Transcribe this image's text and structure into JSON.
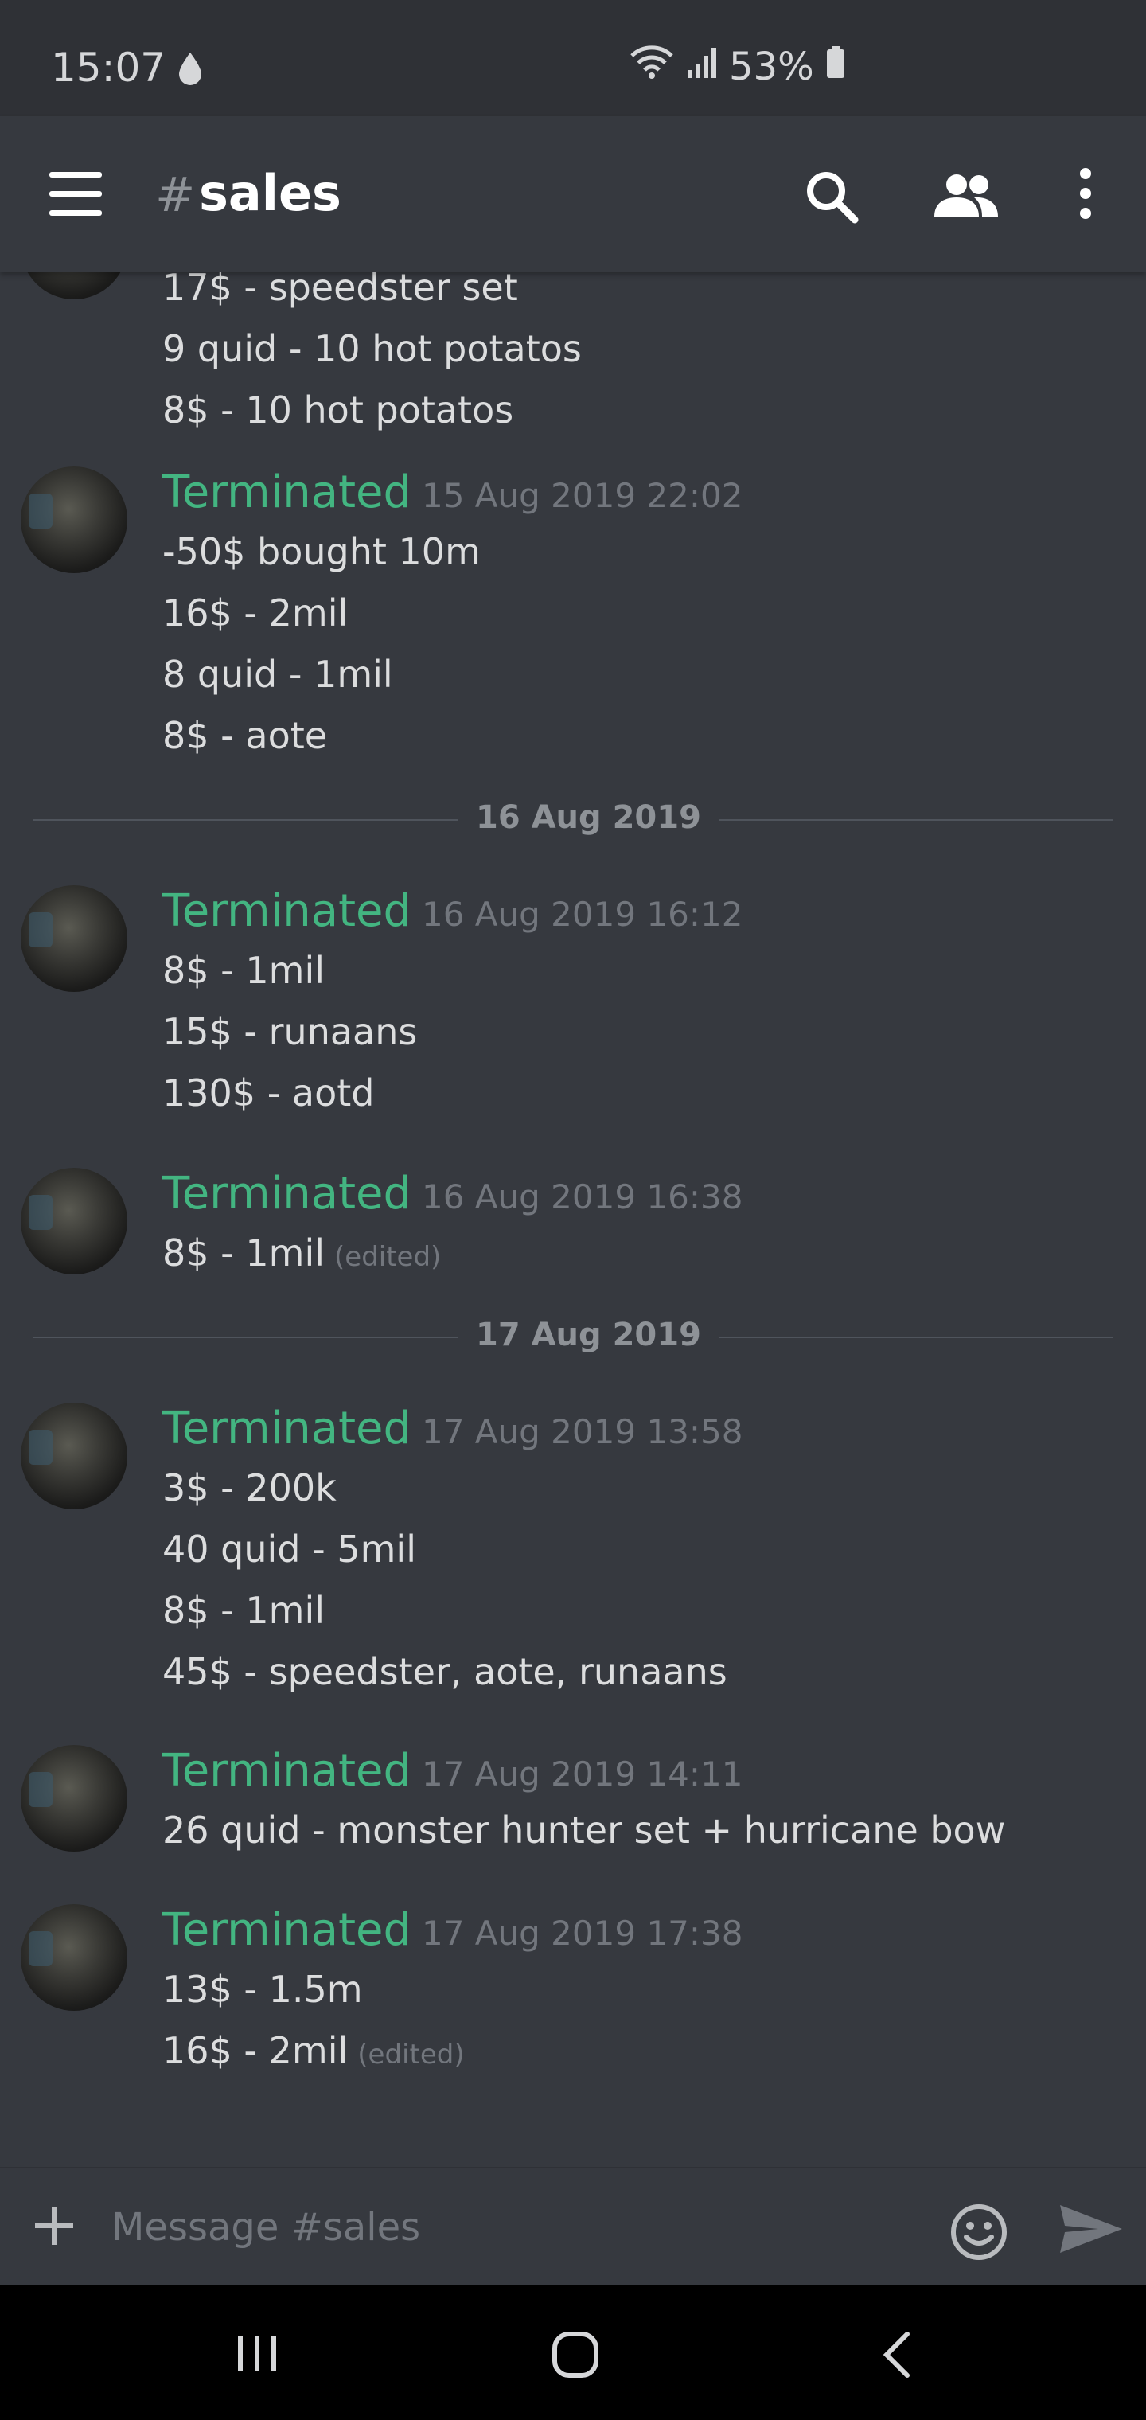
{
  "status": {
    "time": "15:07",
    "battery": "53%",
    "icons": [
      "drop-icon",
      "wifi-icon",
      "signal-icon",
      "battery-icon"
    ]
  },
  "header": {
    "hash": "#",
    "channel": "sales",
    "icons": [
      "menu-icon",
      "search-icon",
      "members-icon",
      "more-icon"
    ]
  },
  "colors": {
    "background": "#36393f",
    "author": "#43b581",
    "timestamp": "#72767d",
    "text": "#dcddde"
  },
  "messages": {
    "partial": {
      "lines": [
        "17$ - speedster set",
        "9 quid - 10 hot potatos",
        "8$ - 10 hot potatos"
      ]
    },
    "m1": {
      "author": "Terminated",
      "time": "15 Aug 2019 22:02",
      "lines": [
        "-50$ bought 10m",
        "16$ - 2mil",
        "8 quid - 1mil",
        "8$ - aote"
      ]
    },
    "divider1": "16 Aug 2019",
    "m2": {
      "author": "Terminated",
      "time": "16 Aug 2019 16:12",
      "lines": [
        "8$ - 1mil",
        "15$ - runaans",
        "130$ - aotd"
      ]
    },
    "m3": {
      "author": "Terminated",
      "time": "16 Aug 2019 16:38",
      "lines": [
        "8$ - 1mil"
      ],
      "edited": "(edited)"
    },
    "divider2": "17 Aug 2019",
    "m4": {
      "author": "Terminated",
      "time": "17 Aug 2019 13:58",
      "lines": [
        "3$ - 200k",
        "40 quid - 5mil",
        "8$ - 1mil",
        "45$ - speedster, aote, runaans"
      ]
    },
    "m5": {
      "author": "Terminated",
      "time": "17 Aug 2019 14:11",
      "lines": [
        "26 quid - monster hunter set + hurricane bow"
      ]
    },
    "m6": {
      "author": "Terminated",
      "time": "17 Aug 2019 17:38",
      "lines": [
        "13$ - 1.5m",
        "16$ - 2mil"
      ],
      "edited": "(edited)"
    }
  },
  "composer": {
    "placeholder": "Message #sales",
    "icons": [
      "plus-icon",
      "emoji-icon",
      "send-icon"
    ]
  },
  "navbar": {
    "icons": [
      "recent-apps-icon",
      "home-icon",
      "back-icon"
    ]
  }
}
